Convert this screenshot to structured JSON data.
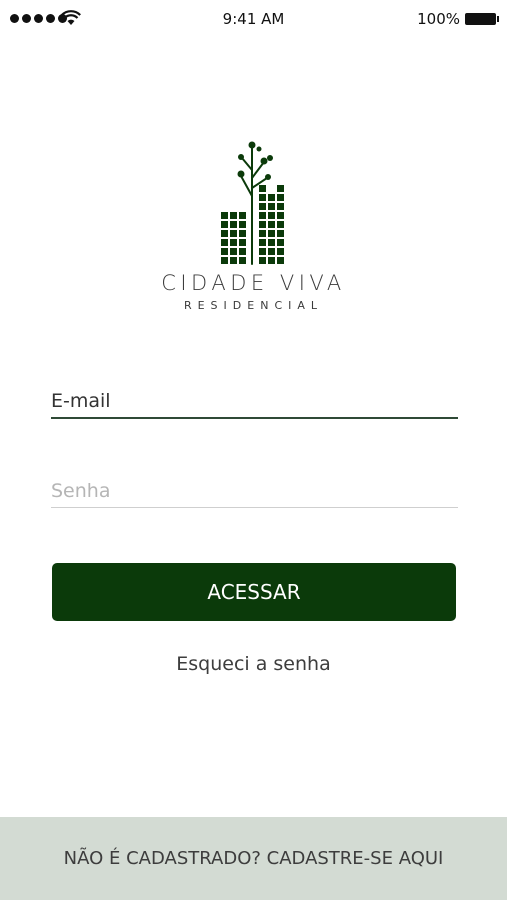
{
  "status_bar": {
    "time": "9:41 AM",
    "battery": "100%",
    "signal_icon": "signal-dots-icon",
    "wifi_icon": "wifi-icon",
    "battery_icon": "battery-icon"
  },
  "brand": {
    "logo_icon": "city-tree-logo-icon",
    "name": "CIDADE VIVA",
    "subtitle": "RESIDENCIAL",
    "color": "#0b3a0a"
  },
  "form": {
    "email_placeholder": "E-mail",
    "password_placeholder": "Senha",
    "submit_label": "ACESSAR",
    "forgot_label": "Esqueci a senha"
  },
  "footer": {
    "signup_label": "NÃO É CADASTRADO? CADASTRE-SE AQUI",
    "background": "#d3dbd3"
  }
}
